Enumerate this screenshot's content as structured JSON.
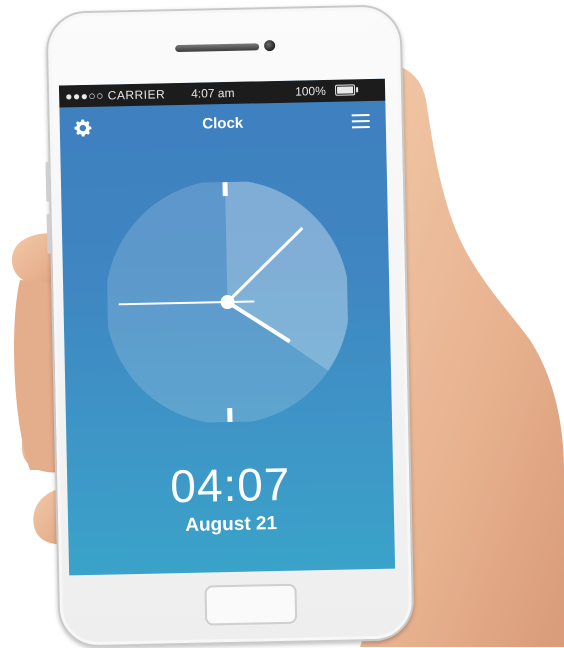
{
  "status_bar": {
    "carrier": "●●●○○ CARRIER",
    "time": "4:07 am",
    "battery": "100%"
  },
  "app": {
    "title": "Clock",
    "left_icon": "gear-icon",
    "right_icon": "menu-icon"
  },
  "clock": {
    "digital_time": "04:07",
    "date": "August 21",
    "analog": {
      "hour": 4,
      "minute": 7,
      "second": 45
    }
  },
  "colors": {
    "screen_top": "#3f7fbf",
    "screen_bottom": "#3aa3c9",
    "status_bar": "#1c1c1c"
  }
}
